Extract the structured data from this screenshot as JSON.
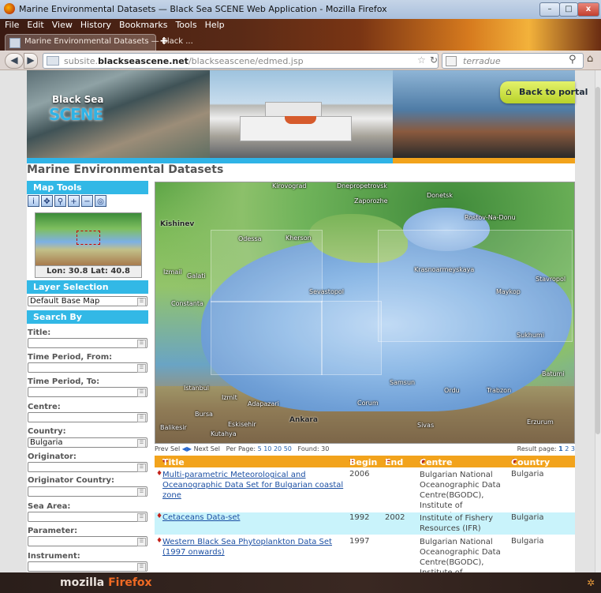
{
  "window": {
    "title": "Marine Environmental Datasets — Black Sea SCENE Web Application - Mozilla Firefox",
    "btn_min": "–",
    "btn_max": "□",
    "btn_close": "x"
  },
  "menubar": [
    "File",
    "Edit",
    "View",
    "History",
    "Bookmarks",
    "Tools",
    "Help"
  ],
  "tab": {
    "label": "Marine Environmental Datasets — Black ...",
    "new_tab": "+"
  },
  "navbar": {
    "url_prefix": "subsite.",
    "url_domain": "blackseascene.net",
    "url_path": "/blackseascene/edmed.jsp",
    "search_placeholder": "terradue"
  },
  "banner": {
    "logo_line1": "Black Sea",
    "logo_line2": "SCENE",
    "back_to_portal": "Back to portal"
  },
  "page_title": "Marine Environmental Datasets",
  "sidebar": {
    "map_tools": "Map Tools",
    "tool_icons": [
      "i",
      "✥",
      "⚲",
      "+",
      "−",
      "◎"
    ],
    "coords": "Lon: 30.8 Lat: 40.8",
    "layer_selection": "Layer Selection",
    "layer_value": "Default Base Map",
    "search_by": "Search By",
    "fields": [
      {
        "label": "Title:",
        "value": ""
      },
      {
        "label": "Time Period, From:",
        "value": ""
      },
      {
        "label": "Time Period, To:",
        "value": ""
      },
      {
        "label": "Centre:",
        "value": ""
      },
      {
        "label": "Country:",
        "value": "Bulgaria"
      },
      {
        "label": "Originator:",
        "value": ""
      },
      {
        "label": "Originator Country:",
        "value": ""
      },
      {
        "label": "Sea Area:",
        "value": ""
      },
      {
        "label": "Parameter:",
        "value": ""
      },
      {
        "label": "Instrument:",
        "value": ""
      }
    ]
  },
  "map": {
    "labels": [
      "Kirovograd",
      "Dnepropetrovsk",
      "Zaporozhe",
      "Donetsk",
      "Rostov-Na-Donu",
      "Kishinev",
      "Odessa",
      "Kherson",
      "Krasnoarmeyskaya",
      "Izmail",
      "Galati",
      "Sevastopol",
      "Stavropol",
      "Maykop",
      "Constanta",
      "Sukhumi",
      "Batumi",
      "Samsun",
      "Ordu",
      "Trabzon",
      "Istanbul",
      "Izmit",
      "Adapazari",
      "Corum",
      "Ankara",
      "Eskisehir",
      "Kutahya",
      "Sivas",
      "Erzurum",
      "Bursa",
      "Balikesir"
    ]
  },
  "pager": {
    "prev": "Prev Sel",
    "next": "Next Sel",
    "per_page_label": "Per Page:",
    "per_page_options": [
      "5",
      "10",
      "20",
      "50"
    ],
    "found": "Found: 30",
    "result_page_label": "Result page:",
    "result_pages": [
      "1",
      "2",
      "3"
    ]
  },
  "table": {
    "headers": {
      "title": "Title",
      "begin": "Begin",
      "end": "End",
      "centre": "Centre",
      "country": "Country"
    },
    "rows": [
      {
        "title": "Multi-parametric Meteorological and Oceanographic Data Set for Bulgarian coastal zone",
        "begin": "2006",
        "end": "",
        "centre": "Bulgarian National Oceanographic Data Centre(BGODC), Institute of Oceanology",
        "country": "Bulgaria"
      },
      {
        "title": "Cetaceans Data-set",
        "begin": "1992",
        "end": "2002",
        "centre": "Institute of Fishery Resources (IFR)",
        "country": "Bulgaria"
      },
      {
        "title": "Western Black Sea Phytoplankton Data Set (1997 onwards)",
        "begin": "1997",
        "end": "",
        "centre": "Bulgarian National Oceanographic Data Centre(BGODC), Institute of Oceanology",
        "country": "Bulgaria"
      }
    ]
  },
  "bottom": {
    "brand_1": "mozilla ",
    "brand_2": "Firefox"
  },
  "colors": {
    "accent_blue": "#32b8e6",
    "accent_orange": "#f2a31c",
    "row_highlight": "#c9f3fb"
  }
}
